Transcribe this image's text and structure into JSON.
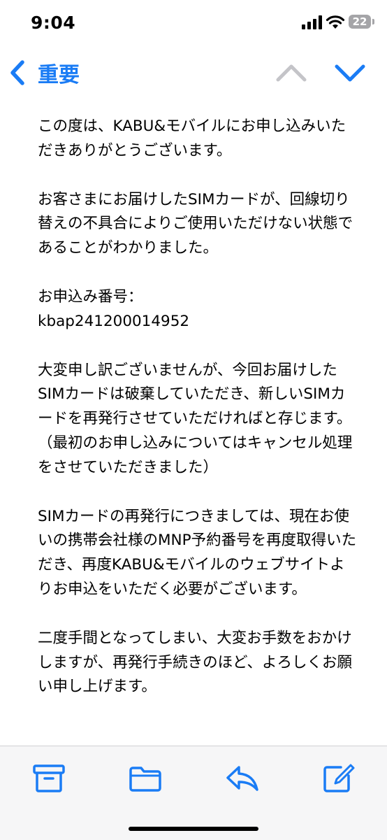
{
  "status_bar": {
    "time": "9:04",
    "battery_level": "22"
  },
  "nav": {
    "back_label": "重要"
  },
  "message": {
    "paragraphs": [
      "この度は、KABU&モバイルにお申し込みいただきありがとうございます。",
      "お客さまにお届けしたSIMカードが、回線切り替えの不具合によりご使用いただけない状態であることがわかりました。",
      "お申込み番号：\nkbap241200014952",
      "大変申し訳ございませんが、今回お届けしたSIMカードは破棄していただき、新しいSIMカードを再発行させていただければと存じます。（最初のお申し込みについてはキャンセル処理をさせていただきました）",
      "SIMカードの再発行につきましては、現在お使いの携帯会社様のMNP予約番号を再度取得いただき、再度KABU&モバイルのウェブサイトよりお申込をいただく必要がございます。",
      "二度手間となってしまい、大変お手数をおかけしますが、再発行手続きのほど、よろしくお願い申し上げます。"
    ]
  },
  "icons": {
    "signal": "cellular-signal-icon",
    "wifi": "wifi-icon",
    "battery": "battery-icon",
    "back": "chevron-left-icon",
    "up": "chevron-up-icon",
    "down": "chevron-down-icon",
    "archive": "archive-box-icon",
    "folder": "folder-icon",
    "reply": "reply-arrow-icon",
    "compose": "compose-icon"
  },
  "colors": {
    "accent": "#1a7cf5",
    "disabled": "#c4c4c8",
    "toolbar_bg": "#f6f6f7"
  }
}
